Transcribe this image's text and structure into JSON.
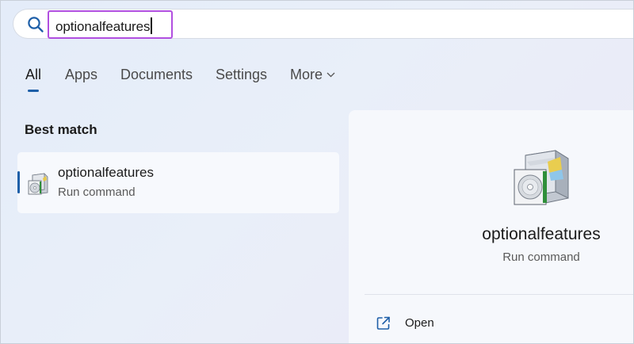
{
  "search": {
    "value": "optionalfeatures"
  },
  "tabs": [
    {
      "label": "All",
      "active": true
    },
    {
      "label": "Apps"
    },
    {
      "label": "Documents"
    },
    {
      "label": "Settings"
    },
    {
      "label": "More"
    }
  ],
  "best_match": {
    "heading": "Best match",
    "title": "optionalfeatures",
    "subtitle": "Run command",
    "icon": "windows-features-box-icon"
  },
  "detail": {
    "title": "optionalfeatures",
    "subtitle": "Run command",
    "icon": "windows-features-box-icon",
    "actions": [
      {
        "label": "Open",
        "icon": "open-external-icon"
      }
    ]
  },
  "colors": {
    "accent": "#1e5fa8",
    "highlight_border": "#b14fe0"
  }
}
